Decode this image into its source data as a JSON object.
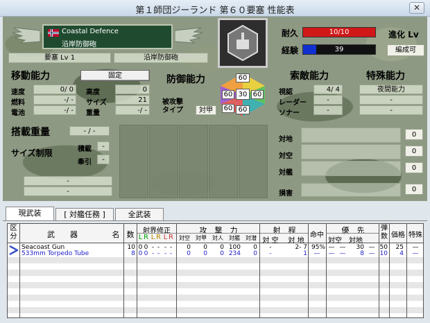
{
  "window": {
    "title": "第１師団ジーランド 第６０要塞 性能表",
    "close_label": "✕"
  },
  "unit": {
    "name_en": "Coastal Defence",
    "name_jp": "沿岸防御砲",
    "type_label": "要塞 Lv 1",
    "class_label": "沿岸防御砲",
    "flag": "norway-flag-icon",
    "portrait": "fortress-emblem-icon"
  },
  "mobility": {
    "header": "移動能力",
    "fixed_label": "固定",
    "speed_label": "速度",
    "speed_value": "0/ 0",
    "altitude_label": "高度",
    "altitude_value": "0",
    "fuel_label": "燃料",
    "fuel_value": "-/ -",
    "size_label": "サイズ",
    "size_value": "21",
    "battery_label": "電池",
    "battery_value": "-/ -",
    "weight_label": "重量",
    "weight_value": "-/ -"
  },
  "defense": {
    "header": "防御能力",
    "attack_type_label": "被攻撃\nタイプ",
    "attack_type_value": "対甲",
    "hex": {
      "top": "60",
      "upper_left": "60",
      "center": "30",
      "upper_right": "60",
      "lower_left": "60",
      "lower_right": "60"
    }
  },
  "status": {
    "hp_label": "耐久",
    "hp_value": "10/10",
    "hp_ratio": 1.0,
    "exp_label": "経験",
    "exp_value": "39",
    "exp_ratio": 0.18,
    "evolve_label": "進化 Lv",
    "evolve_state": "編成可"
  },
  "detection": {
    "header": "索敵能力",
    "vision_label": "視認",
    "vision_value": "4/ 4",
    "radar_label": "レーダー",
    "radar_value": "-",
    "sonar_label": "ソナー",
    "sonar_value": "-"
  },
  "special": {
    "header": "特殊能力",
    "items": [
      "夜間能力",
      "-",
      "-"
    ]
  },
  "cargo": {
    "header": "搭載重量",
    "weight_value": "- / -",
    "size_limit_label": "サイズ制限",
    "load_label": "積載",
    "load_value": "-",
    "tow_label": "牽引",
    "tow_value": "-",
    "bottom_values": [
      "-",
      "-"
    ]
  },
  "targets": {
    "ground_label": "対地",
    "ground_value": "0",
    "air_label": "対空",
    "air_value": "0",
    "ship_label": "対艦",
    "ship_value": "0",
    "damage_label": "損害",
    "damage_value": "0"
  },
  "tabs": [
    "現武装",
    "[ 対艦任務 ]",
    "全武装"
  ],
  "table": {
    "headers": {
      "category": "区\n分",
      "weapon": "武　　器",
      "name": "名",
      "count": "数",
      "range_fix": "射界修正",
      "lr": [
        "L",
        "R",
        "L",
        "R",
        "L",
        "R"
      ],
      "attack": "攻　撃　力",
      "attack_sub": [
        "対空",
        "対甲",
        "対人",
        "対艦",
        "対潜"
      ],
      "range": "射　程",
      "range_sub": [
        "対 空",
        "対 地"
      ],
      "accuracy": "命中",
      "priority": "優　先",
      "priority_sub": [
        "対空",
        "対地"
      ],
      "ammo": "弾\n数",
      "price": "価格",
      "special": "特殊"
    },
    "rows": [
      {
        "name": "Seacoast Gun",
        "count": "10",
        "fix": [
          "0",
          "0",
          "-",
          "-",
          "-",
          "-"
        ],
        "atk": [
          "0",
          "0",
          "0",
          "100",
          "0"
        ],
        "rng_air": "-",
        "rng_gnd": "2-  7",
        "acc": "95%",
        "pri_air": "—",
        "pri_gnd": "30",
        "pri_x": "—",
        "ammo": "50",
        "price": "25",
        "special": "—",
        "color": "#000000"
      },
      {
        "name": "533mm Torpedo Tube",
        "count": "8",
        "fix": [
          "0",
          "0",
          "-",
          "-",
          "-",
          "-"
        ],
        "atk": [
          "0",
          "0",
          "0",
          "234",
          "0"
        ],
        "rng_air": "-",
        "rng_gnd": "1",
        "acc": "—",
        "pri_air": "—",
        "pri_gnd": "8",
        "pri_x": "—",
        "ammo": "10",
        "price": "4",
        "special": "—",
        "color": "#1a1acc"
      }
    ]
  }
}
